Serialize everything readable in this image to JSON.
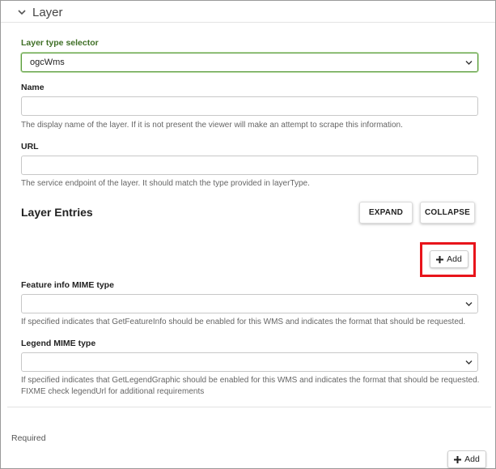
{
  "section": {
    "title": "Layer",
    "icon": "chevron-down-icon"
  },
  "layer_type": {
    "label": "Layer type selector",
    "value": "ogcWms",
    "accent": "#3f6f26"
  },
  "name": {
    "label": "Name",
    "value": "",
    "help": "The display name of the layer. If it is not present the viewer will make an attempt to scrape this information."
  },
  "url": {
    "label": "URL",
    "value": "",
    "help": "The service endpoint of the layer. It should match the type provided in layerType."
  },
  "layer_entries": {
    "title": "Layer Entries",
    "expand_label": "EXPAND",
    "collapse_label": "COLLAPSE",
    "add_label": "Add",
    "highlight_color": "#e8141b"
  },
  "feature_info": {
    "label": "Feature info MIME type",
    "value": "",
    "help": "If specified indicates that GetFeatureInfo should be enabled for this WMS and indicates the format that should be requested."
  },
  "legend": {
    "label": "Legend MIME type",
    "value": "",
    "help": "If specified indicates that GetLegendGraphic should be enabled for this WMS and indicates the format that should be requested. FIXME check legendUrl for additional requirements"
  },
  "footer": {
    "required_label": "Required",
    "add_label": "Add"
  }
}
